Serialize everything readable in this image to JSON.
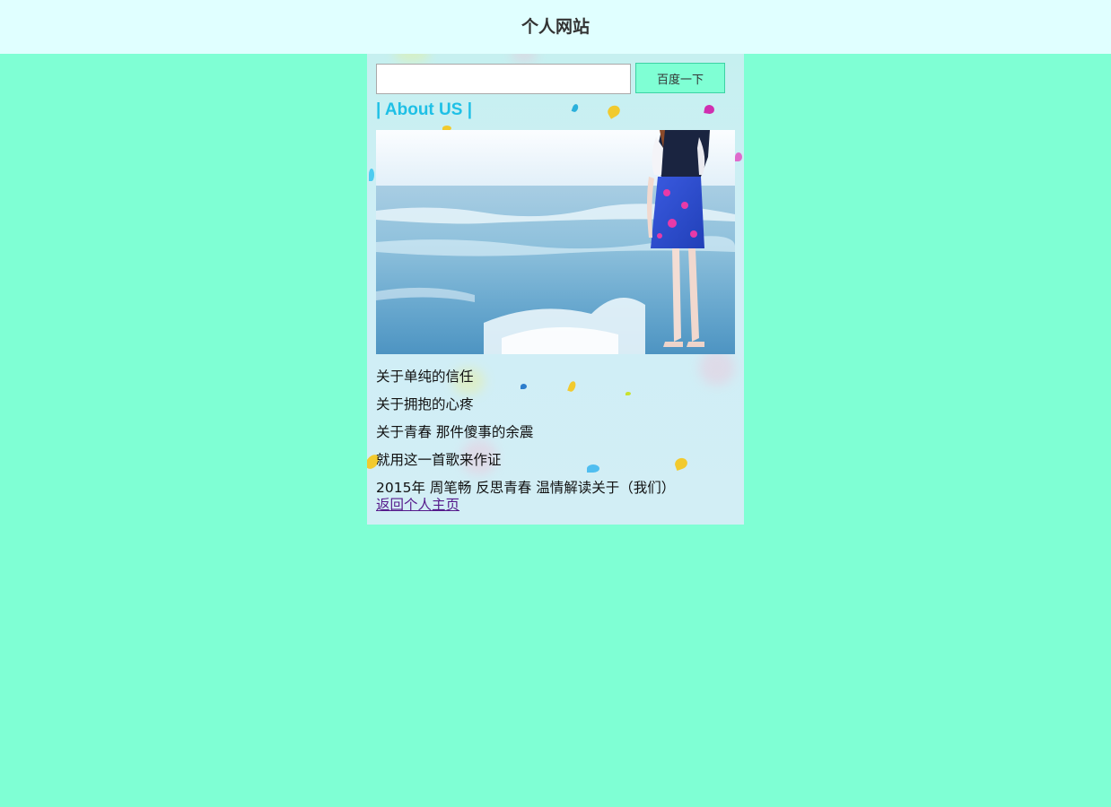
{
  "header": {
    "title": "个人网站"
  },
  "search": {
    "value": "",
    "placeholder": "",
    "button_label": "百度一下"
  },
  "about": {
    "heading": "| About US |"
  },
  "content": {
    "lines": [
      "关于单纯的信任",
      "关于拥抱的心疼",
      "关于青春 那件傻事的余震",
      "就用这一首歌来作证",
      "2015年 周笔畅 反思青春 温情解读关于（我们）"
    ],
    "link_label": "返回个人主页"
  },
  "colors": {
    "page_background": "#7fffd4",
    "header_background": "#e0ffff",
    "heading_color": "#1ec0e6",
    "button_background": "#7fffd4",
    "link_color": "#551a8b"
  },
  "icons": {
    "photo": "beach-girl-photo"
  }
}
